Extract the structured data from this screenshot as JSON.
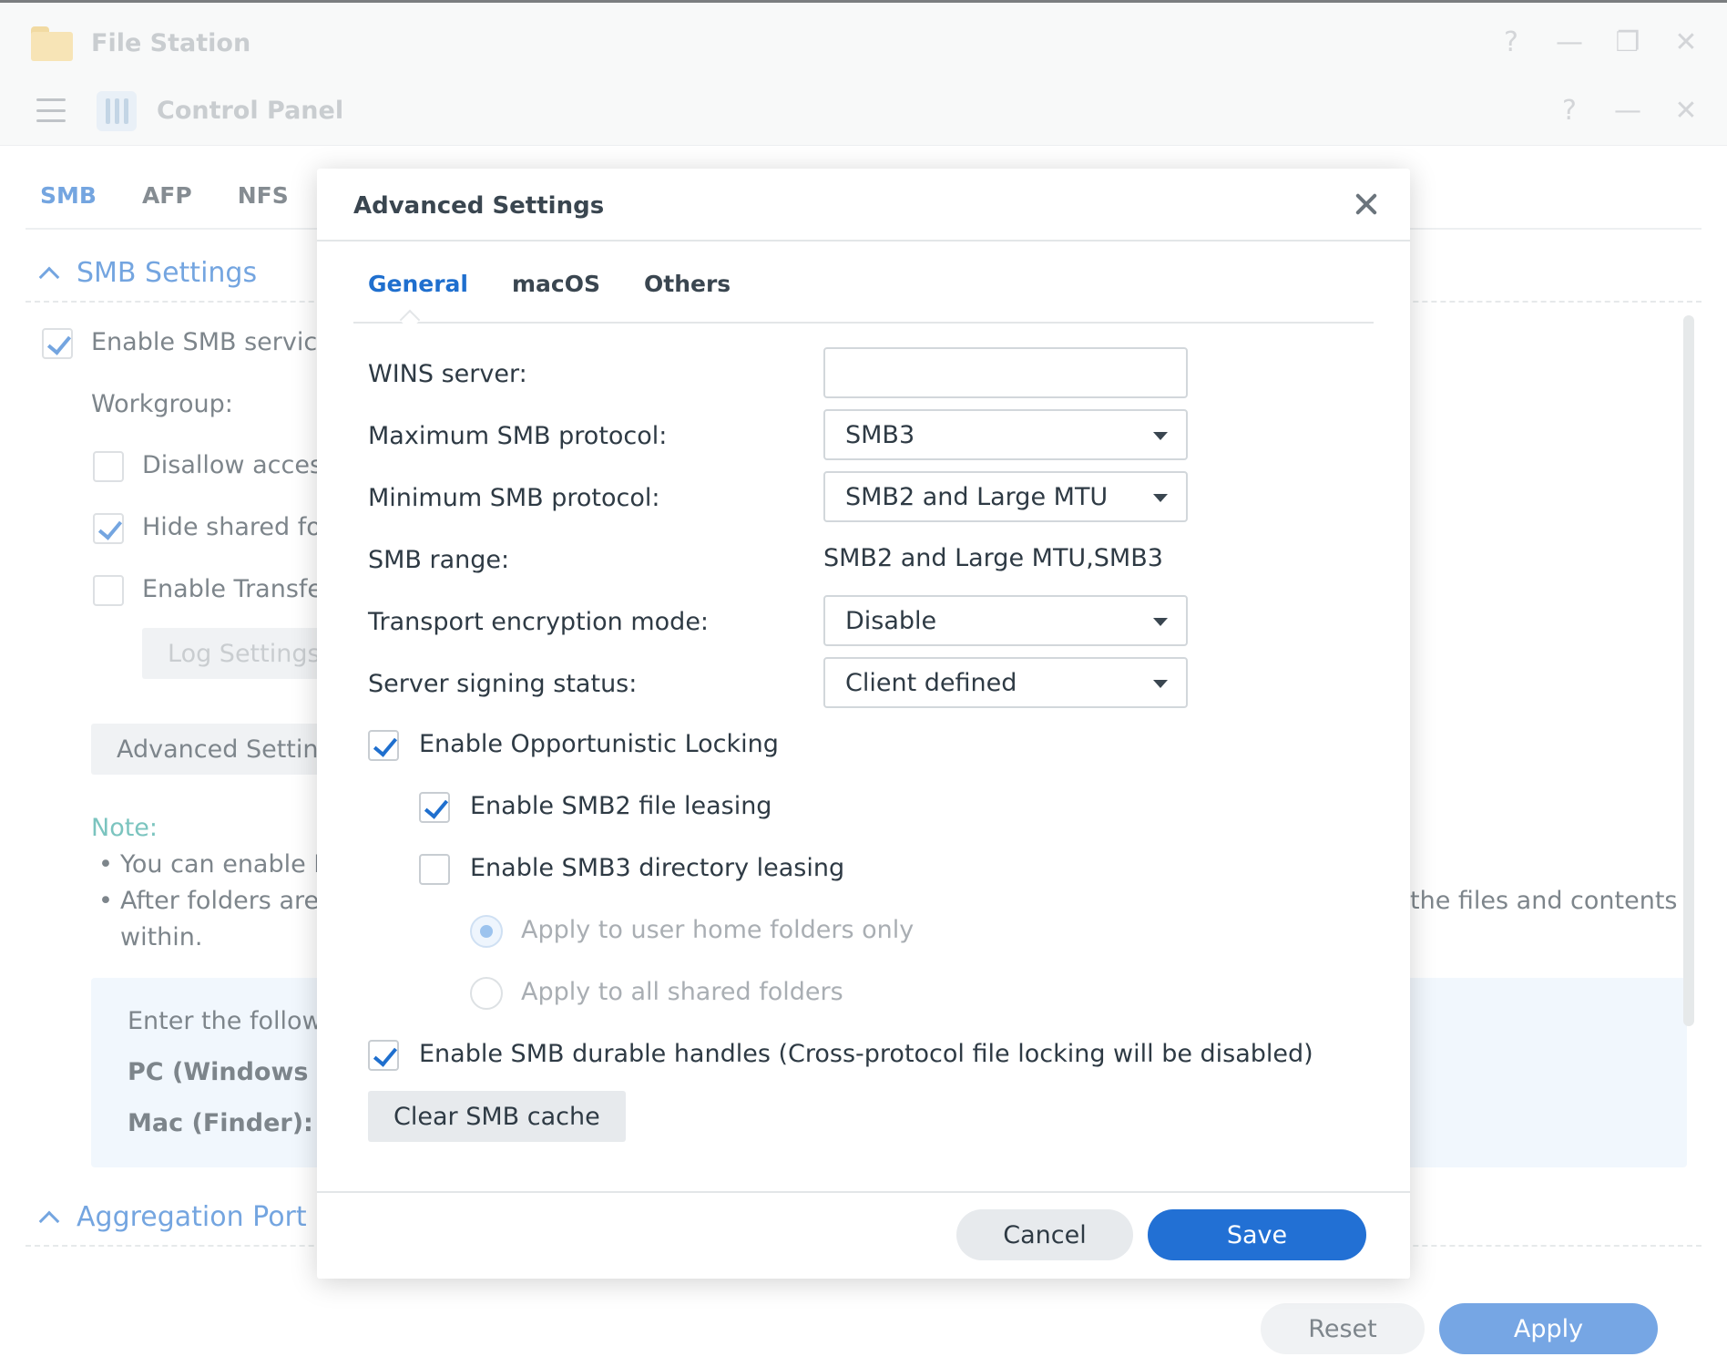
{
  "file_station": {
    "title": "File Station",
    "controls": [
      "?",
      "—",
      "❐",
      "✕"
    ]
  },
  "control_panel": {
    "title": "Control Panel",
    "controls": [
      "?",
      "—",
      "✕"
    ],
    "tabs": [
      {
        "label": "SMB",
        "active": true
      },
      {
        "label": "AFP",
        "active": false
      },
      {
        "label": "NFS",
        "active": false
      }
    ],
    "smb_section": {
      "title": "SMB Settings",
      "enable_smb": {
        "label": "Enable SMB service",
        "checked": true
      },
      "workgroup_label": "Workgroup:",
      "disallow_access": {
        "label": "Disallow access",
        "checked": false
      },
      "hide_shared": {
        "label": "Hide shared fo",
        "checked": true
      },
      "enable_transfer": {
        "label": "Enable Transfe",
        "checked": false
      },
      "log_settings_label": "Log Settings",
      "advanced_settings_label": "Advanced Setting",
      "note_title": "Note:",
      "note_lines": [
        "You can enable F",
        "After folders are",
        "the files and contents",
        "within."
      ],
      "info_box": {
        "line1": "Enter the follow",
        "pc_label": "PC (Windows I",
        "mac_label": "Mac (Finder):"
      }
    },
    "aggregation_section": {
      "title": "Aggregation Port"
    },
    "footer": {
      "reset_label": "Reset",
      "apply_label": "Apply"
    }
  },
  "dialog": {
    "title": "Advanced Settings",
    "tabs": [
      {
        "label": "General",
        "active": true
      },
      {
        "label": "macOS",
        "active": false
      },
      {
        "label": "Others",
        "active": false
      }
    ],
    "fields": {
      "wins_server": {
        "label": "WINS server:",
        "value": ""
      },
      "max_smb": {
        "label": "Maximum SMB protocol:",
        "value": "SMB3"
      },
      "min_smb": {
        "label": "Minimum SMB protocol:",
        "value": "SMB2 and Large MTU"
      },
      "smb_range": {
        "label": "SMB range:",
        "value": "SMB2 and Large MTU,SMB3"
      },
      "transport_encryption": {
        "label": "Transport encryption mode:",
        "value": "Disable"
      },
      "server_signing": {
        "label": "Server signing status:",
        "value": "Client defined"
      }
    },
    "checkboxes": {
      "oplock": {
        "label": "Enable Opportunistic Locking",
        "checked": true
      },
      "smb2_leasing": {
        "label": "Enable SMB2 file leasing",
        "checked": true
      },
      "smb3_dir_leasing": {
        "label": "Enable SMB3 directory leasing",
        "checked": false
      },
      "durable_handles": {
        "label": "Enable SMB durable handles (Cross-protocol file locking will be disabled)",
        "checked": true
      }
    },
    "radios": {
      "home_only": {
        "label": "Apply to user home folders only",
        "checked": true
      },
      "all_shared": {
        "label": "Apply to all shared folders",
        "checked": false
      }
    },
    "clear_cache_label": "Clear SMB cache",
    "cancel_label": "Cancel",
    "save_label": "Save"
  },
  "colors": {
    "accent": "#1f6fce",
    "primary_button": "#2270d4",
    "note": "#2aa198",
    "info_box": "#e8f2fc"
  }
}
